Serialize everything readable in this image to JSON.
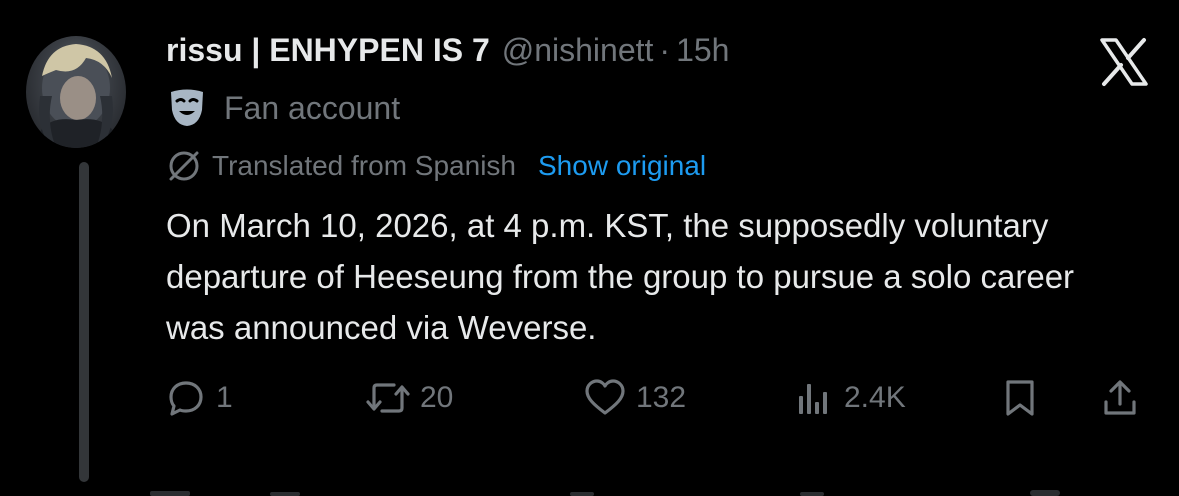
{
  "tweet": {
    "display_name": "rissu | ENHYPEN IS 7",
    "handle": "@nishinett",
    "separator": "·",
    "time": "15h",
    "badge_label": "Fan account",
    "translated_from": "Translated from Spanish",
    "show_original_label": "Show original",
    "text": "On March 10, 2026, at 4 p.m. KST, the supposedly voluntary departure of Heeseung from the group to pursue a solo career was announced via Weverse."
  },
  "actions": {
    "reply_count": "1",
    "repost_count": "20",
    "like_count": "132",
    "views_count": "2.4K"
  },
  "icons": {
    "reply": "speech-bubble-icon",
    "repost": "repost-icon",
    "like": "heart-icon",
    "views": "bar-chart-icon",
    "bookmark": "bookmark-icon",
    "share": "share-icon",
    "platform": "x-logo-icon",
    "badge": "theater-mask-icon",
    "translate": "translate-icon"
  },
  "colors": {
    "background": "#000000",
    "primary_text": "#e7e9ea",
    "secondary_text": "#71767b",
    "link": "#1d9bf0"
  }
}
